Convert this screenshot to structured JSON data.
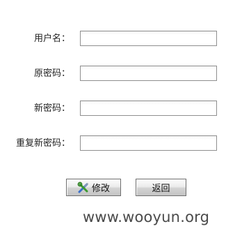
{
  "form": {
    "fields": [
      {
        "label": "用户名：",
        "value": "",
        "placeholder": ""
      },
      {
        "label": "原密码：",
        "value": "",
        "placeholder": ""
      },
      {
        "label": "新密码：",
        "value": "",
        "placeholder": ""
      },
      {
        "label": "重复新密码：",
        "value": "",
        "placeholder": ""
      }
    ],
    "modify_button": {
      "label": "修改",
      "icon": "tools-icon"
    },
    "back_button": {
      "label": "返回"
    }
  },
  "watermark": {
    "text": "www.wooyun.org"
  },
  "colors": {
    "input_border": "#8f8f8f",
    "button_border": "#6f6f6f",
    "watermark": "#4a4a4a"
  }
}
